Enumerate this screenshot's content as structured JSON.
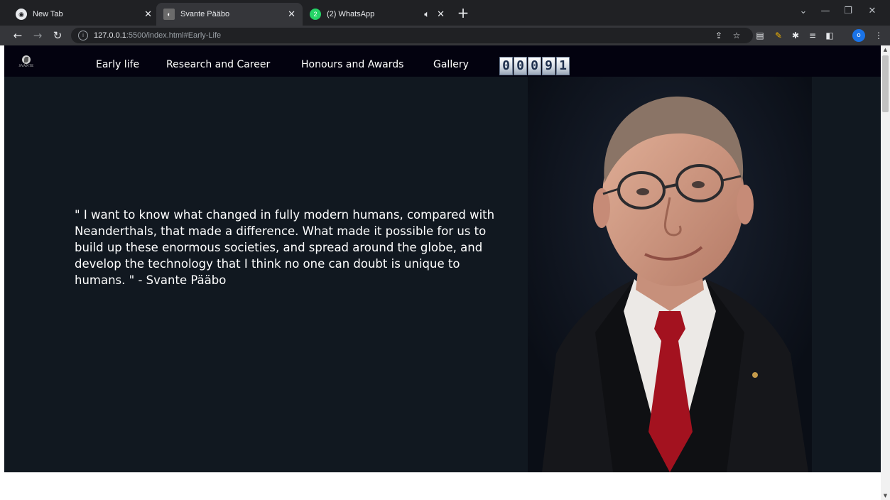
{
  "browser": {
    "tabs": [
      {
        "title": "New Tab",
        "favicon": "chrome-icon",
        "active": false
      },
      {
        "title": "Svante Pääbo",
        "favicon": "svante-logo-icon",
        "active": true
      },
      {
        "title": "(2) WhatsApp",
        "favicon": "whatsapp-icon",
        "active": false,
        "badge": "2"
      }
    ],
    "url_host": "127.0.0.1",
    "url_rest": ":5500/index.html#Early-Life",
    "profile_initial": "o",
    "accent": "#1a73e8"
  },
  "site": {
    "logo_text": "SVANTE",
    "nav": [
      "Early life",
      "Research and Career",
      "Honours and Awards",
      "Gallery"
    ],
    "counter_digits": [
      "0",
      "0",
      "0",
      "9",
      "1"
    ],
    "quote": "\" I want to know what changed in fully modern humans, compared with Neanderthals, that made a difference. What made it possible for us to build up these enormous societies, and spread around the globe, and develop the technology that I think no one can doubt is unique to humans. \" - Svante Pääbo",
    "colors": {
      "nav_background": "#03020f",
      "hero_background": "#111820",
      "text": "#ffffff",
      "tie": "#a3121f"
    }
  }
}
